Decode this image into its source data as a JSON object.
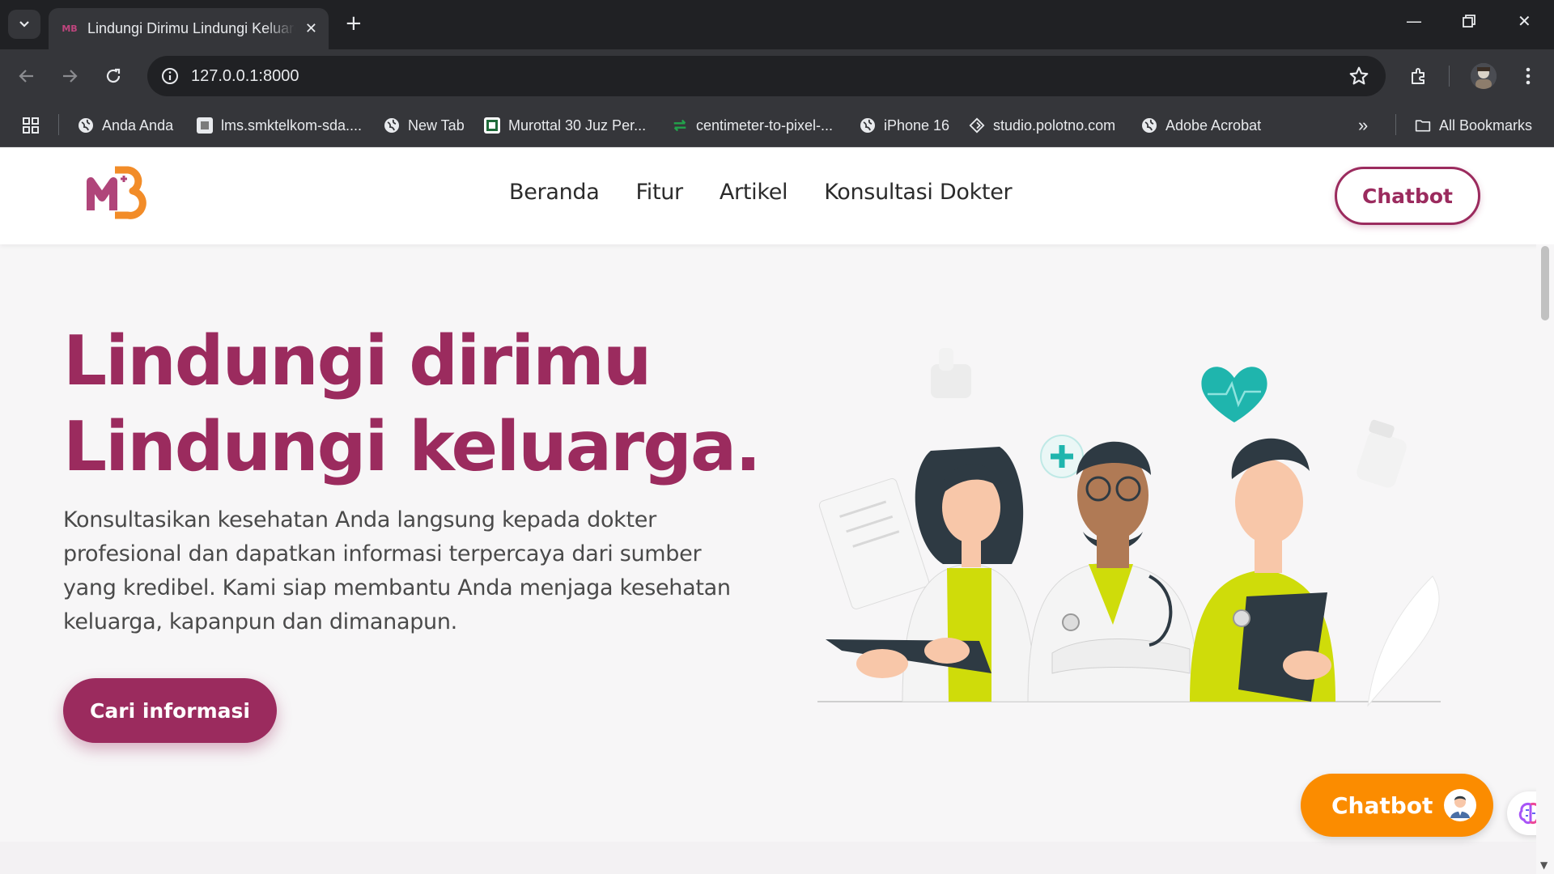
{
  "browser": {
    "tab_title": "Lindungi Dirimu Lindungi Keluarga",
    "tab_favicon": "MB",
    "url": "127.0.0.1:8000",
    "bookmarks": [
      {
        "label": "Anda Anda",
        "icon": "globe-icon"
      },
      {
        "label": "lms.smktelkom-sda....",
        "icon": "site-icon"
      },
      {
        "label": "New Tab",
        "icon": "globe-icon"
      },
      {
        "label": "Murottal 30 Juz Per...",
        "icon": "site-icon"
      },
      {
        "label": "centimeter-to-pixel-...",
        "icon": "arrows-icon"
      },
      {
        "label": "iPhone 16",
        "icon": "globe-icon"
      },
      {
        "label": "studio.polotno.com",
        "icon": "polotno-icon"
      },
      {
        "label": "Adobe Acrobat",
        "icon": "globe-icon"
      }
    ],
    "all_bookmarks": "All Bookmarks"
  },
  "nav": {
    "items": [
      "Beranda",
      "Fitur",
      "Artikel",
      "Konsultasi Dokter"
    ],
    "chatbot": "Chatbot"
  },
  "hero": {
    "title_line1": "Lindungi dirimu",
    "title_line2": "Lindungi keluarga.",
    "description": "Konsultasikan kesehatan Anda langsung kepada dokter profesional dan dapatkan informasi terpercaya dari sumber yang kredibel. Kami siap membantu Anda menjaga kesehatan keluarga, kapanpun dan dimanapun.",
    "cta": "Cari informasi"
  },
  "floating": {
    "chatbot": "Chatbot"
  },
  "colors": {
    "brand": "#9b2b5e",
    "accent": "#fb8c00",
    "lime": "#cfdc0a",
    "teal": "#1fb5ad"
  }
}
